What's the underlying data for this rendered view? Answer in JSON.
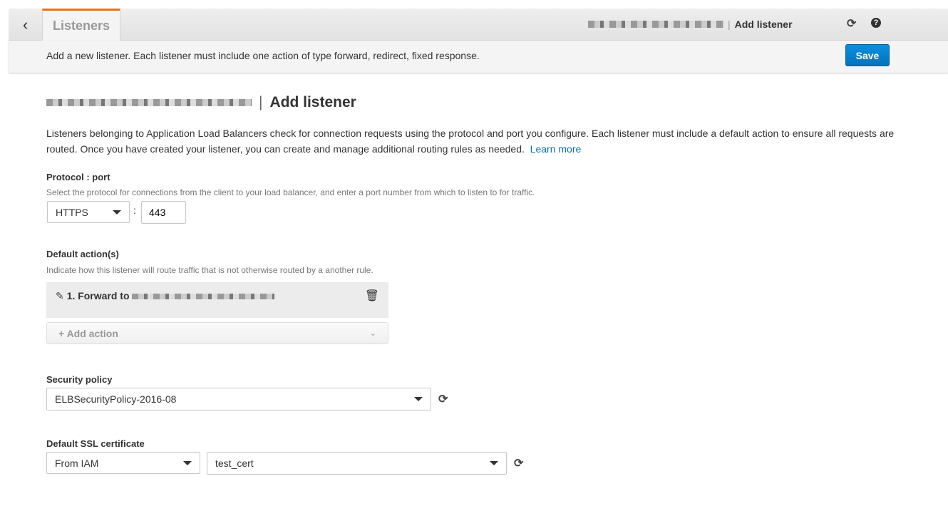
{
  "header": {
    "back_icon": "chevron-left-icon",
    "tab_label": "Listeners",
    "breadcrumb_current": "Add listener",
    "refresh_icon": "refresh-icon",
    "help_icon": "help-icon"
  },
  "subbar": {
    "text": "Add a new listener. Each listener must include one action of type forward, redirect, fixed response.",
    "save_label": "Save"
  },
  "page": {
    "title": "Add listener",
    "description": "Listeners belonging to Application Load Balancers check for connection requests using the protocol and port you configure. Each listener must include a default action to ensure all requests are routed. Once you have created your listener, you can create and manage additional routing rules as needed.",
    "learn_more": "Learn more"
  },
  "protocol": {
    "label": "Protocol : port",
    "help": "Select the protocol for connections from the client to your load balancer, and enter a port number from which to listen to for traffic.",
    "protocol_value": "HTTPS",
    "separator": ":",
    "port_value": "443"
  },
  "default_actions": {
    "label": "Default action(s)",
    "help": "Indicate how this listener will route traffic that is not otherwise routed by a another rule.",
    "actions": [
      {
        "label": "1. Forward to"
      }
    ],
    "add_action_label": "Add action"
  },
  "security_policy": {
    "label": "Security policy",
    "value": "ELBSecurityPolicy-2016-08"
  },
  "ssl_cert": {
    "label": "Default SSL certificate",
    "source": "From IAM",
    "certificate": "test_cert"
  },
  "colors": {
    "accent": "#ec7211",
    "primary_button": "#0073bb",
    "link": "#0073bb"
  }
}
